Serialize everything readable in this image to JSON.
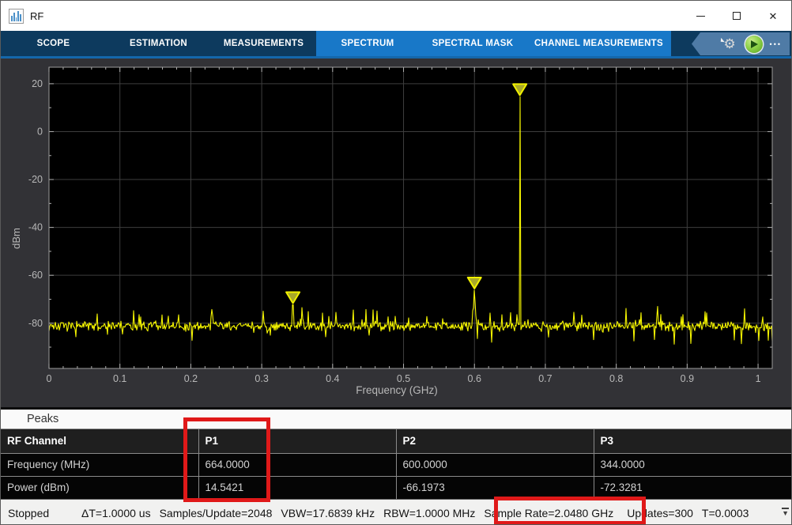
{
  "window": {
    "title": "RF"
  },
  "icons": {
    "app": "histogram-icon",
    "close_glyph": "✕",
    "ellipsis_glyph": "•••",
    "gear_glyph": "⚙",
    "grip_glyph": "▼"
  },
  "tabbar": {
    "tabs": [
      {
        "label": "SCOPE",
        "active": false
      },
      {
        "label": "ESTIMATION",
        "active": false
      },
      {
        "label": "MEASUREMENTS",
        "active": false
      },
      {
        "label": "SPECTRUM",
        "active": true
      },
      {
        "label": "SPECTRAL MASK",
        "active": true
      },
      {
        "label": "CHANNEL MEASUREMENTS",
        "active": true
      }
    ],
    "bg_color": "#0d3a5e",
    "active_bg_color": "#1878c8"
  },
  "chart_data": {
    "type": "line",
    "xlabel": "Frequency (GHz)",
    "ylabel": "dBm",
    "xlim": [
      0,
      1.02
    ],
    "ylim": [
      -98.9,
      26.9
    ],
    "xticks": [
      0,
      0.1,
      0.2,
      0.3,
      0.4,
      0.5,
      0.6,
      0.7,
      0.8,
      0.9,
      1
    ],
    "xtick_labels": [
      "0",
      "0.1",
      "0.2",
      "0.3",
      "0.4",
      "0.5",
      "0.6",
      "0.7",
      "0.8",
      "0.9",
      "1"
    ],
    "yticks": [
      20,
      0,
      -20,
      -40,
      -60,
      -80
    ],
    "ytick_labels": [
      "20",
      "0",
      "-20",
      "-40",
      "-60",
      "-80"
    ],
    "minor_x_step": 0.02,
    "minor_y_step": 10,
    "grid": true,
    "grid_color": "#3e3e3e",
    "axes_bg": "#000000",
    "tick_color": "#b0b0b0",
    "trace_color": "#f5f500",
    "marker_fill": "#a9a92a",
    "marker_stroke": "#f0f000",
    "noise_floor_dbm": -81.2,
    "noise_seed": 7,
    "peaks": [
      {
        "label": "P1",
        "freq_ghz": 0.664,
        "power_dbm": 14.5421
      },
      {
        "label": "P2",
        "freq_ghz": 0.6,
        "power_dbm": -66.1973
      },
      {
        "label": "P3",
        "freq_ghz": 0.344,
        "power_dbm": -72.3281
      }
    ],
    "spurs": [
      {
        "freq_ghz": 0.302,
        "power_dbm": -75.0
      },
      {
        "freq_ghz": 0.357,
        "power_dbm": -73.5
      },
      {
        "freq_ghz": 0.405,
        "power_dbm": -75.5
      },
      {
        "freq_ghz": 0.858,
        "power_dbm": -73.0
      }
    ]
  },
  "peaks_panel": {
    "title": "Peaks",
    "table": {
      "headers": [
        "RF Channel",
        "P1",
        "P2",
        "P3"
      ],
      "rows": [
        {
          "label": "Frequency (MHz)",
          "values": [
            "664.0000",
            "600.0000",
            "344.0000"
          ]
        },
        {
          "label": "Power (dBm)",
          "values": [
            "14.5421",
            "-66.1973",
            "-72.3281"
          ]
        }
      ]
    }
  },
  "statusbar": {
    "state": "Stopped",
    "delta_t": "ΔT=1.0000 us",
    "samples_per_update": "Samples/Update=2048",
    "vbw": "VBW=17.6839 kHz",
    "rbw": "RBW=1.0000 MHz",
    "sample_rate": "Sample Rate=2.0480 GHz",
    "updates": "Updates=300",
    "t": "T=0.0003"
  },
  "annotations": {
    "color": "#e01919",
    "boxes": [
      {
        "target": "p1-column"
      },
      {
        "target": "sample-rate"
      }
    ]
  }
}
